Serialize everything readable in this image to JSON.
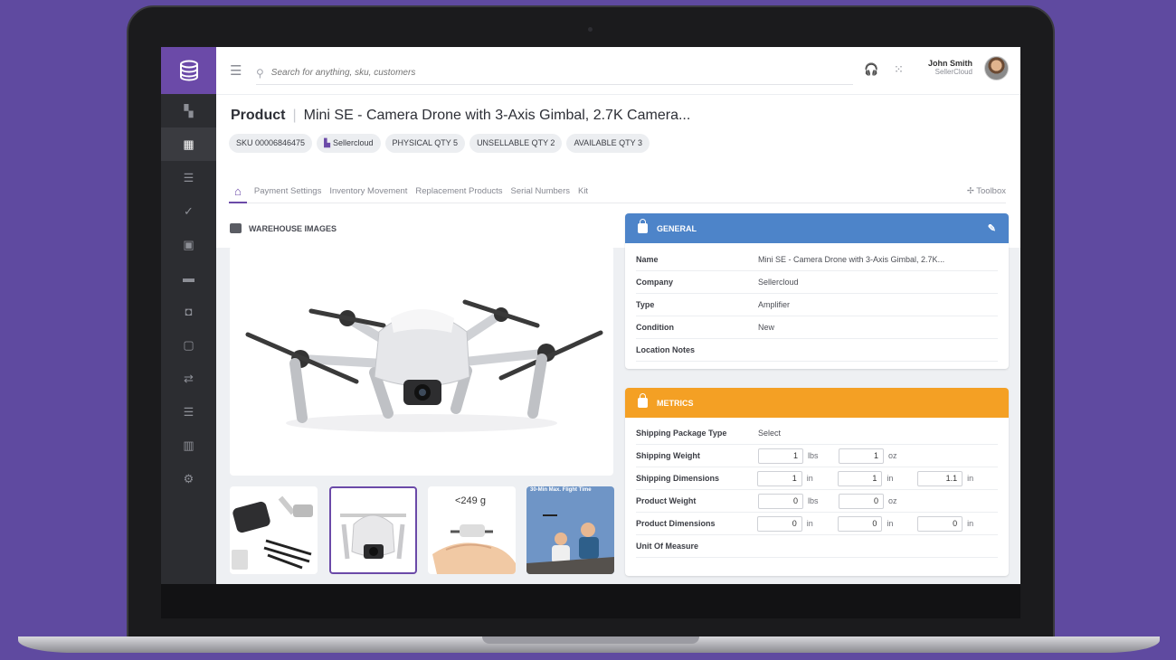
{
  "search": {
    "placeholder": "Search for anything, sku, customers"
  },
  "user": {
    "name": "John Smith",
    "company": "SellerCloud"
  },
  "product": {
    "label": "Product",
    "name": "Mini SE - Camera Drone with 3-Axis Gimbal, 2.7K Camera...",
    "chips": {
      "sku": "SKU 00006846475",
      "company": "Sellercloud",
      "physical": "PHYSICAL QTY 5",
      "unsellable": "UNSELLABLE QTY 2",
      "available": "AVAILABLE QTY 3"
    }
  },
  "tabs": [
    "Payment Settings",
    "Inventory Movement",
    "Replacement Products",
    "Serial Numbers",
    "Kit"
  ],
  "toolbox": "Toolbox",
  "images": {
    "title": "WAREHOUSE IMAGES",
    "thumb3_text": "<249 g",
    "thumb4_text": "30-Min Max. Flight Time"
  },
  "general": {
    "title": "GENERAL",
    "color": "#4d84c9",
    "rows": [
      {
        "label": "Name",
        "value": "Mini SE - Camera Drone with 3-Axis Gimbal, 2.7K..."
      },
      {
        "label": "Company",
        "value": "Sellercloud"
      },
      {
        "label": "Type",
        "value": "Amplifier"
      },
      {
        "label": "Condition",
        "value": "New"
      },
      {
        "label": "Location Notes",
        "value": ""
      }
    ]
  },
  "metrics": {
    "title": "METRICS",
    "color": "#f4a024",
    "package_type": {
      "label": "Shipping Package Type",
      "value": "Select"
    },
    "shipping_weight": {
      "label": "Shipping Weight",
      "v1": "1",
      "u1": "lbs",
      "v2": "1",
      "u2": "oz"
    },
    "shipping_dims": {
      "label": "Shipping Dimensions",
      "v1": "1",
      "v2": "1",
      "v3": "1.1",
      "unit": "in"
    },
    "product_weight": {
      "label": "Product Weight",
      "v1": "0",
      "u1": "lbs",
      "v2": "0",
      "u2": "oz"
    },
    "product_dims": {
      "label": "Product Dimensions",
      "v1": "0",
      "v2": "0",
      "v3": "0",
      "unit": "in"
    },
    "unit_of_measure": {
      "label": "Unit Of Measure"
    }
  },
  "accent": "#6b4aa8"
}
